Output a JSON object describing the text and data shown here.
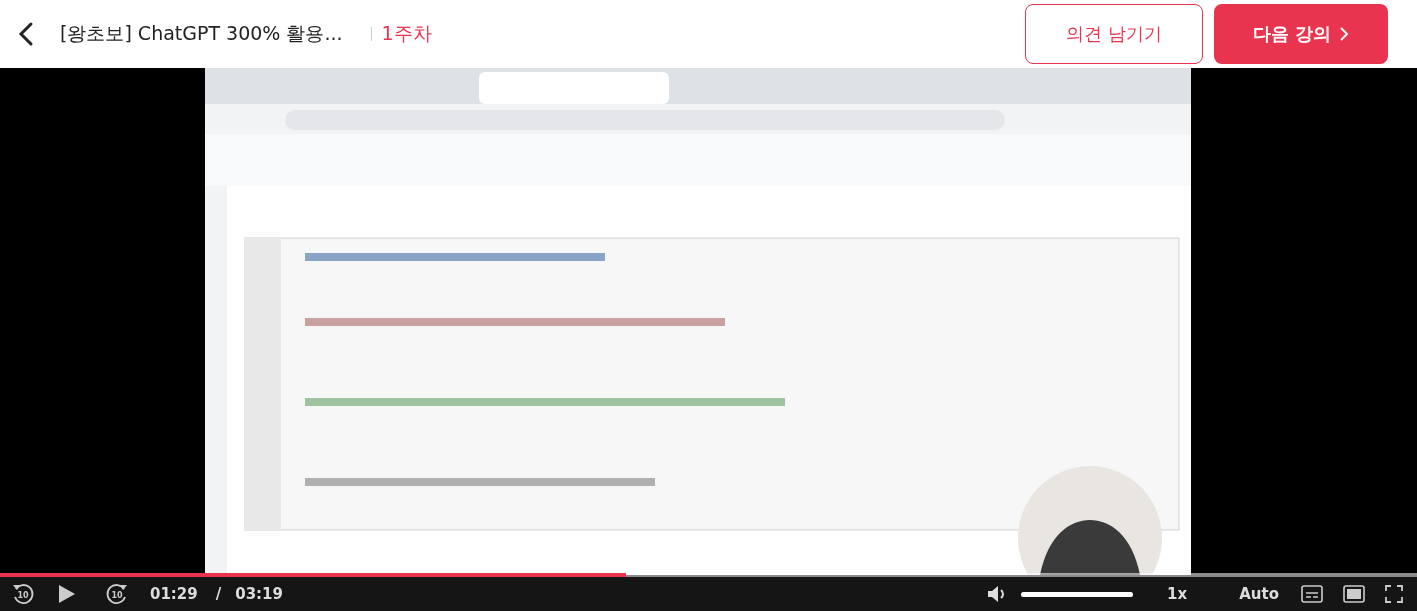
{
  "header": {
    "title": "[왕초보] ChatGPT 300% 활용...",
    "week": "1주차",
    "buttons": [
      {
        "kind": "outline",
        "label": "의견 남기기"
      },
      {
        "kind": "primary",
        "label": "다음 강의"
      }
    ]
  },
  "player": {
    "progress": {
      "level": 0.442
    },
    "rewind_label": "10",
    "forward_label": "10",
    "current_time": "01:29",
    "separator": "/",
    "duration": "03:19",
    "volume": {
      "level": 1
    },
    "speed": "1x",
    "quality": "Auto"
  }
}
